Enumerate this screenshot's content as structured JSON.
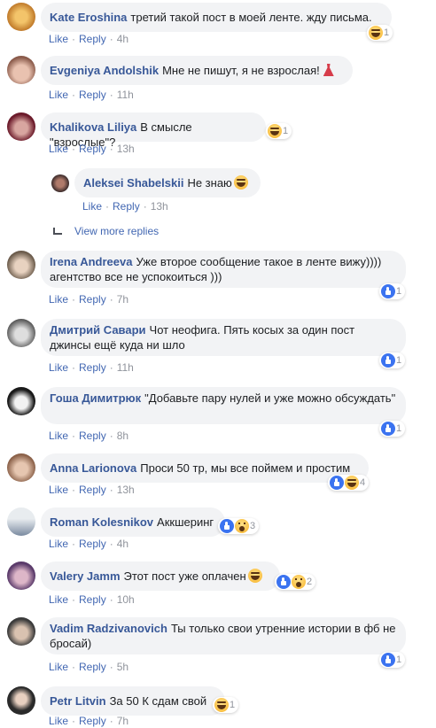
{
  "action_labels": {
    "like": "Like",
    "reply": "Reply"
  },
  "view_more_replies": "View more replies",
  "comments": [
    {
      "author": "Kate Eroshina",
      "text": "третий такой пост в моей ленте. жду письма.",
      "time": "4h",
      "reactions": [
        {
          "type": "haha"
        }
      ],
      "reaction_count": "1"
    },
    {
      "author": "Evgeniya Andolshik",
      "text": "Мне не пишут, я не взрослая!",
      "time": "11h",
      "inline_emoji": "dress"
    },
    {
      "author": "Khalikova Liliya",
      "text": "В смысле \"взрослые\"?",
      "time": "13h",
      "reactions": [
        {
          "type": "haha"
        }
      ],
      "reaction_count": "1"
    },
    {
      "author": "Aleksei Shabelskii",
      "text": "Не знаю",
      "time": "13h",
      "is_reply": true,
      "inline_emoji": "haha"
    },
    {
      "author": "Irena Andreeva",
      "text": "Уже второе сообщение такое в ленте вижу)))) агентство все не успокоиться )))",
      "time": "7h",
      "reactions": [
        {
          "type": "like"
        }
      ],
      "reaction_count": "1"
    },
    {
      "author": "Дмитрий Савари",
      "text": "Чот неофига. Пять косых за один пост джинсы ещё куда ни шло",
      "time": "11h",
      "reactions": [
        {
          "type": "like"
        }
      ],
      "reaction_count": "1"
    },
    {
      "author": "Гоша Димитрюк",
      "text": "\"Добавьте пару нулей и уже можно обсуждать\"",
      "time": "8h",
      "reactions": [
        {
          "type": "like"
        }
      ],
      "reaction_count": "1"
    },
    {
      "author": "Anna Larionova",
      "text": "Проси 50 тр, мы все поймем и простим",
      "time": "13h",
      "reactions": [
        {
          "type": "like"
        },
        {
          "type": "haha"
        }
      ],
      "reaction_count": "4"
    },
    {
      "author": "Roman Kolesnikov",
      "text": "Аккшеринг",
      "time": "4h",
      "reactions": [
        {
          "type": "like"
        },
        {
          "type": "wow"
        }
      ],
      "reaction_count": "3"
    },
    {
      "author": "Valery Jamm",
      "text": "Этот пост уже оплачен",
      "time": "10h",
      "inline_emoji": "haha",
      "reactions": [
        {
          "type": "like"
        },
        {
          "type": "wow"
        }
      ],
      "reaction_count": "2"
    },
    {
      "author": "Vadim Radzivanovich",
      "text": "Ты только свои утренние истории в фб не бросай)",
      "time": "5h",
      "reactions": [
        {
          "type": "like"
        }
      ],
      "reaction_count": "1"
    },
    {
      "author": "Petr Litvin",
      "text": "За 50 К сдам свой",
      "time": "7h",
      "reactions": [
        {
          "type": "haha"
        }
      ],
      "reaction_count": "1"
    }
  ],
  "colors": {
    "author": "#385898",
    "link": "#4267b2",
    "time": "#90949c",
    "bubble": "#f2f3f5",
    "like": "#3b73f0",
    "haha": "#f7b125"
  }
}
